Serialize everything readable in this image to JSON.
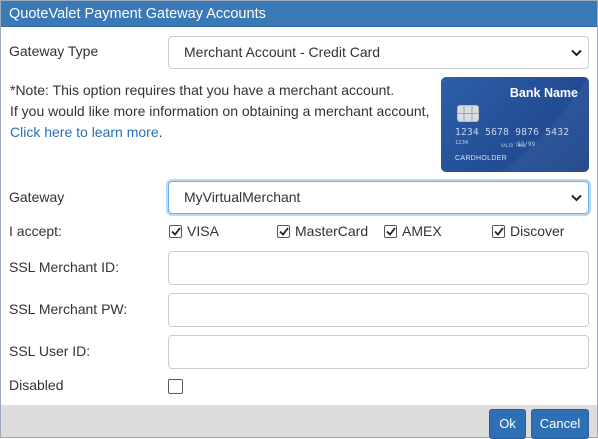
{
  "dialog": {
    "title": "QuoteValet Payment Gateway Accounts"
  },
  "gateway_type": {
    "label": "Gateway Type",
    "value": "Merchant Account - Credit Card"
  },
  "note": {
    "line1": "*Note: This option requires that you have a merchant account.",
    "line2": "If you would like more information on obtaining a merchant account,",
    "link": "Click here to learn more",
    "link_suffix": "."
  },
  "card_image": {
    "bank_name": "Bank Name",
    "number": "1234 5678 9876 5432",
    "small_code": "1234",
    "valid_label": "VALID THRU",
    "expiry": "12/99",
    "holder": "CARDHOLDER"
  },
  "gateway": {
    "label": "Gateway",
    "value": "MyVirtualMerchant"
  },
  "accept": {
    "label": "I accept:",
    "options": [
      {
        "label": "VISA",
        "checked": true
      },
      {
        "label": "MasterCard",
        "checked": true
      },
      {
        "label": "AMEX",
        "checked": true
      },
      {
        "label": "Discover",
        "checked": true
      }
    ]
  },
  "fields": {
    "merchant_id_label": "SSL Merchant ID:",
    "merchant_id_value": "",
    "merchant_pw_label": "SSL Merchant PW:",
    "merchant_pw_value": "",
    "user_id_label": "SSL User ID:",
    "user_id_value": ""
  },
  "disabled": {
    "label": "Disabled",
    "checked": false
  },
  "buttons": {
    "ok": "Ok",
    "cancel": "Cancel"
  },
  "colors": {
    "title_bar": "#3b78b6",
    "link": "#2a6fb0",
    "button": "#2f6fb3",
    "focus": "#66afe9"
  }
}
